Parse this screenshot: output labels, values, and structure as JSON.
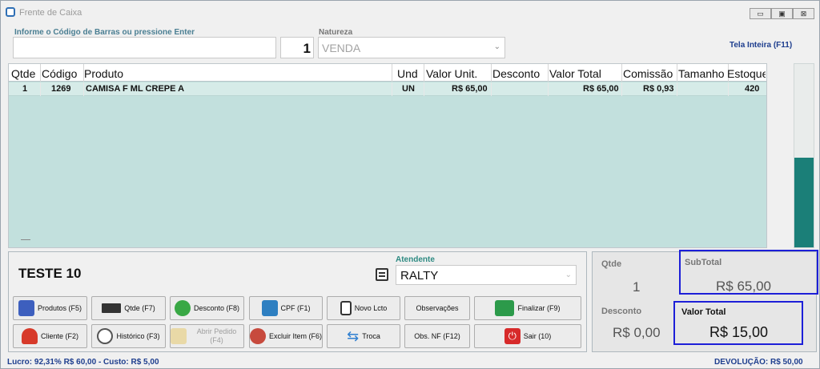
{
  "window": {
    "title": "Frente de Caixa",
    "btn_min": "▭",
    "btn_max": "▣",
    "btn_close": "⊠"
  },
  "barcode": {
    "label": "Informe o Código de Barras ou pressione Enter",
    "value": ""
  },
  "quantity_input": {
    "value": "1"
  },
  "natureza": {
    "label": "Natureza",
    "value": "VENDA"
  },
  "fullscreen_label": "Tela Inteira (F11)",
  "grid": {
    "columns": [
      "Qtde",
      "Código",
      "Produto",
      "Und",
      "Valor Unit.",
      "Desconto",
      "Valor Total",
      "Comissão",
      "Tamanho",
      "Estoque"
    ],
    "rows": [
      {
        "qtde": "1",
        "codigo": "1269",
        "produto": "CAMISA F ML CREPE A",
        "und": "UN",
        "valor_unit": "R$ 65,00",
        "desconto": "",
        "valor_total": "R$ 65,00",
        "comissao": "R$ 0,93",
        "tamanho": "",
        "estoque": "420"
      }
    ]
  },
  "stock_level": 0.49,
  "client_name": "TESTE 10",
  "atendente": {
    "label": "Atendente",
    "value": "RALTY"
  },
  "buttons": {
    "produtos": "Produtos (F5)",
    "qtde": "Qtde (F7)",
    "desconto": "Desconto (F8)",
    "cpf": "CPF (F1)",
    "novo_lcto": "Novo Lcto",
    "observacoes": "Observações",
    "finalizar": "Finalizar (F9)",
    "cliente": "Cliente (F2)",
    "historico": "Histórico (F3)",
    "abrir_pedido": "Abrir Pedido (F4)",
    "excluir_item": "Excluir Item (F6)",
    "troca": "Troca",
    "obs_nf": "Obs. NF (F12)",
    "sair": "Sair (10)"
  },
  "summary": {
    "qtde_label": "Qtde",
    "qtde_value": "1",
    "subtotal_label": "SubTotal",
    "subtotal_value": "R$ 65,00",
    "desconto_label": "Desconto",
    "desconto_value": "R$ 0,00",
    "valor_total_label": "Valor Total",
    "valor_total_value": "R$ 15,00"
  },
  "footer": {
    "lucro": "Lucro: 92,31% R$ 60,00 - Custo: R$ 5,00",
    "devolucao": "DEVOLUÇÃO: R$ 50,00"
  },
  "colors": {
    "grid_bg": "#c2e0dd",
    "accent_teal": "#1b7f78",
    "highlight_border": "#1d1fd8",
    "footer_text": "#1e3e8e"
  }
}
